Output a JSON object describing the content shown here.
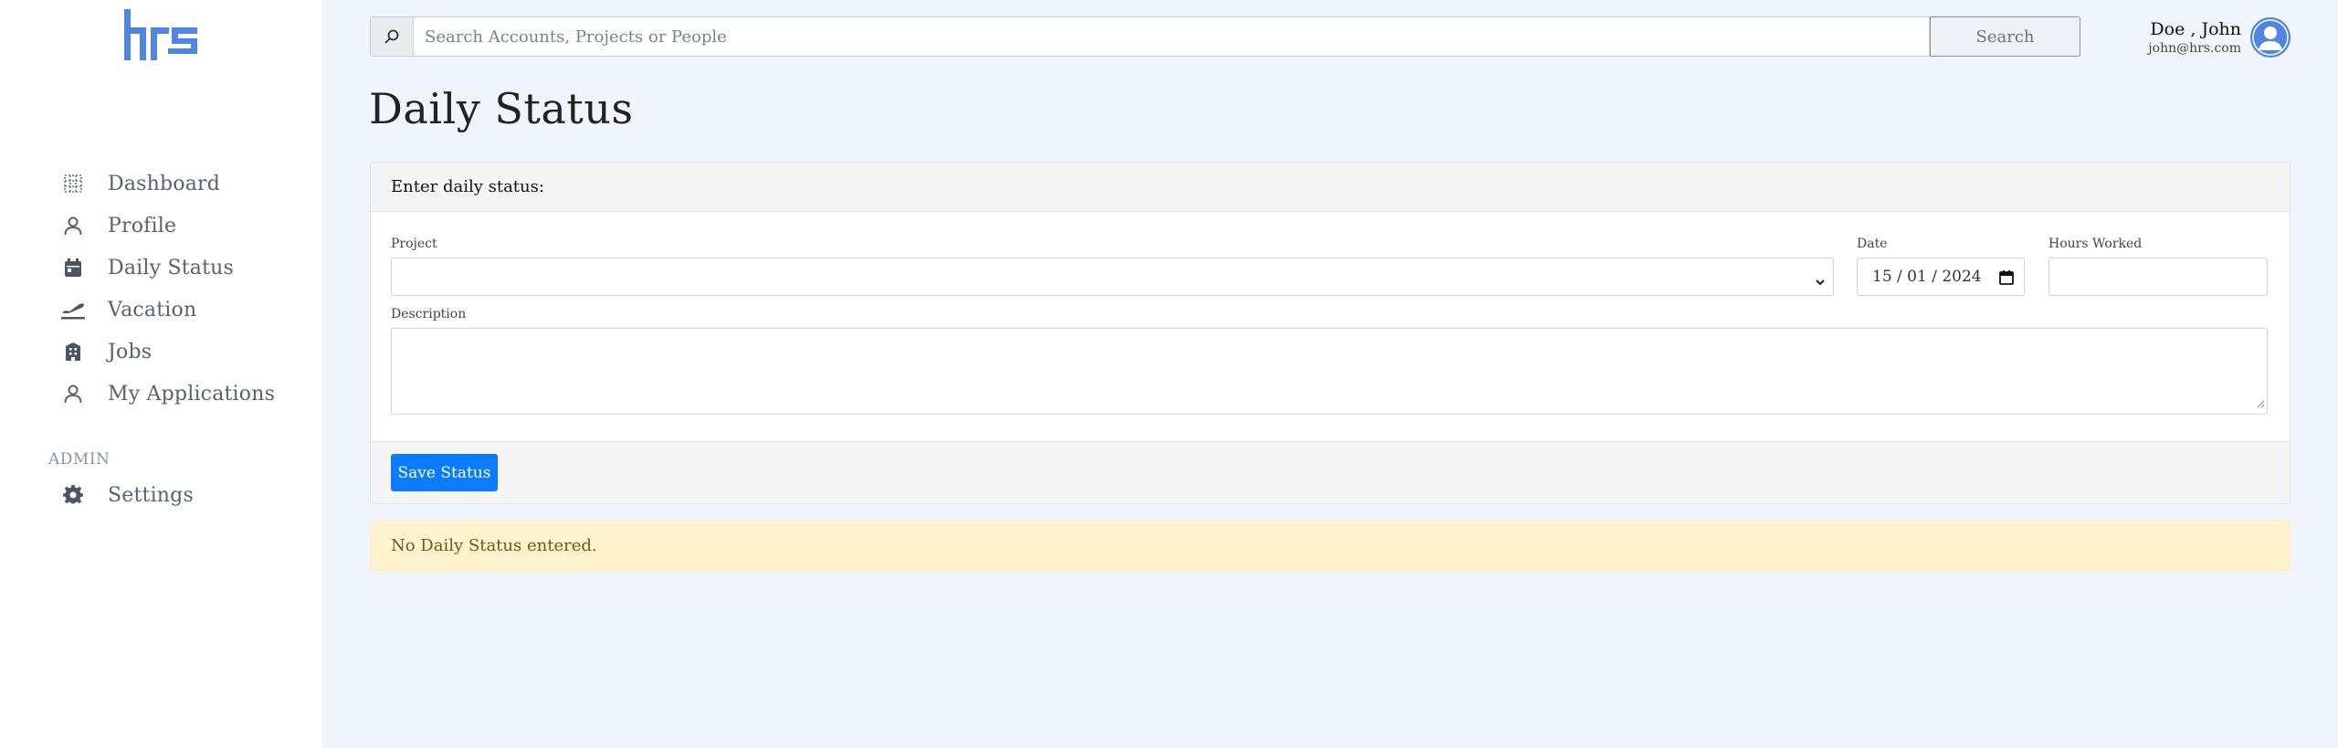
{
  "brand": {
    "logo_text": "hrs"
  },
  "sidebar": {
    "items": [
      {
        "label": "Dashboard",
        "icon": "dashboard-grid-icon"
      },
      {
        "label": "Profile",
        "icon": "user-icon"
      },
      {
        "label": "Daily Status",
        "icon": "calendar-icon"
      },
      {
        "label": "Vacation",
        "icon": "plane-icon"
      },
      {
        "label": "Jobs",
        "icon": "building-icon"
      },
      {
        "label": "My Applications",
        "icon": "user-icon"
      }
    ],
    "admin_label": "ADMIN",
    "admin_items": [
      {
        "label": "Settings",
        "icon": "gear-icon"
      }
    ]
  },
  "topbar": {
    "search_placeholder": "Search Accounts, Projects or People",
    "search_button": "Search",
    "user_name": "Doe , John",
    "user_email": "john@hrs.com"
  },
  "page": {
    "title": "Daily Status",
    "card_header": "Enter daily status:",
    "project_label": "Project",
    "date_label": "Date",
    "date_value": "15 / 01 / 2024",
    "hours_label": "Hours Worked",
    "description_label": "Description",
    "save_button": "Save Status",
    "empty_message": "No Daily Status entered."
  },
  "colors": {
    "accent": "#0b7bff",
    "brand": "#4f86e6",
    "alert_bg": "#fff3cd",
    "page_bg": "#f0f4fb"
  }
}
